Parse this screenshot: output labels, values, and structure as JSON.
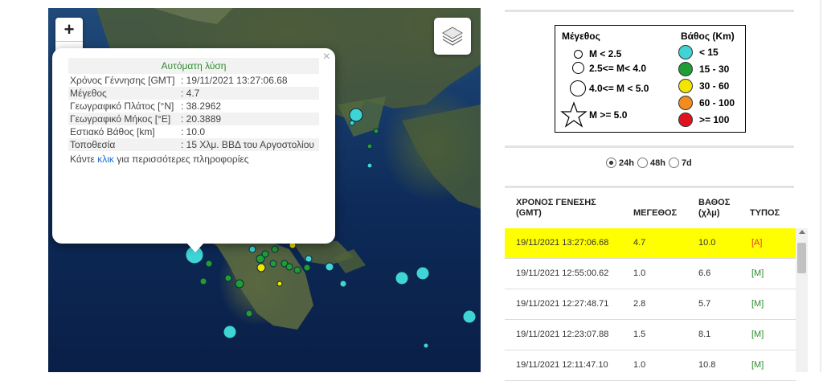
{
  "map": {
    "zoom_in": "+",
    "zoom_out": "−",
    "popup": {
      "close": "×",
      "title": "Αυτόματη λύση",
      "rows": [
        {
          "key": "Χρόνος Γέννησης [GMT]",
          "value": ": 19/11/2021 13:27:06.68"
        },
        {
          "key": "Μέγεθος",
          "value": ": 4.7"
        },
        {
          "key": "Γεωγραφικό Πλάτος [°N]",
          "value": ": 38.2962"
        },
        {
          "key": "Γεωγραφικό Μήκος [°E]",
          "value": ": 20.3889"
        },
        {
          "key": "Εστιακό Βάθος [km]",
          "value": ": 10.0"
        },
        {
          "key": "Τοποθεσία",
          "value": ": 15 Χλμ. ΒΒΔ του Αργοστολίου"
        }
      ],
      "more_prefix": "Κάντε ",
      "more_link": "κλικ",
      "more_suffix": " για περισσότερες πληροφορίες"
    }
  },
  "legend": {
    "size_title": "Μέγεθος",
    "depth_title": "Βάθος (Km)",
    "sizes": [
      "M < 2.5",
      "2.5<= M< 4.0",
      "4.0<= M < 5.0",
      "M >= 5.0"
    ],
    "depths": [
      {
        "label": "< 15",
        "color": "#3fd4d8"
      },
      {
        "label": "15 - 30",
        "color": "#1e9e35"
      },
      {
        "label": "30 - 60",
        "color": "#f2e600"
      },
      {
        "label": "60 - 100",
        "color": "#f28c1e"
      },
      {
        "label": ">= 100",
        "color": "#e0141e"
      }
    ]
  },
  "periods": [
    {
      "label": "24h",
      "selected": true
    },
    {
      "label": "48h",
      "selected": false
    },
    {
      "label": "7d",
      "selected": false
    }
  ],
  "table": {
    "headers": [
      "ΧΡΟΝΟΣ ΓΕΝΕΣΗΣ (GMT)",
      "ΜΕΓΕΘΟΣ",
      "ΒΑΘΟΣ (χλμ)",
      "ΤΥΠΟΣ"
    ],
    "rows": [
      {
        "time": "19/11/2021 13:27:06.68",
        "mag": "4.7",
        "depth": "10.0",
        "type": "[A]"
      },
      {
        "time": "19/11/2021 12:55:00.62",
        "mag": "1.0",
        "depth": "6.6",
        "type": "[M]"
      },
      {
        "time": "19/11/2021 12:27:48.71",
        "mag": "2.8",
        "depth": "5.7",
        "type": "[M]"
      },
      {
        "time": "19/11/2021 12:23:07.88",
        "mag": "1.5",
        "depth": "8.1",
        "type": "[M]"
      },
      {
        "time": "19/11/2021 12:11:47.10",
        "mag": "1.0",
        "depth": "10.8",
        "type": "[M]"
      }
    ]
  }
}
